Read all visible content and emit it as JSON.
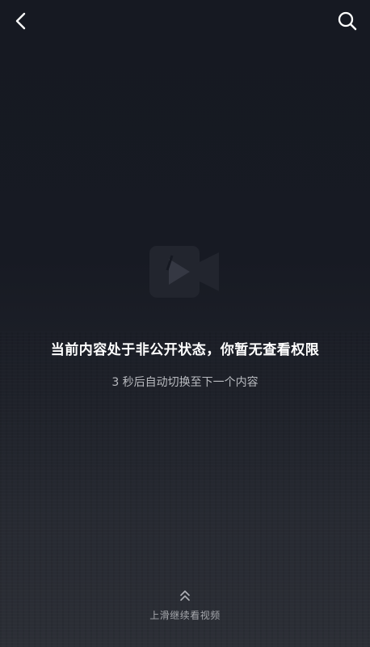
{
  "header": {
    "back_icon": "chevron-left-icon",
    "search_icon": "search-icon"
  },
  "main": {
    "placeholder_icon": "video-play-icon",
    "message": "当前内容处于非公开状态，你暂无查看权限",
    "countdown": "3 秒后自动切换至下一个内容"
  },
  "footer": {
    "swipe_icon": "double-chevron-up-icon",
    "swipe_label": "上滑继续看视频"
  },
  "colors": {
    "background_top": "#161922",
    "background_bottom": "#2c2f36",
    "primary_text": "#ffffff",
    "secondary_text": "#b9bbc0"
  }
}
